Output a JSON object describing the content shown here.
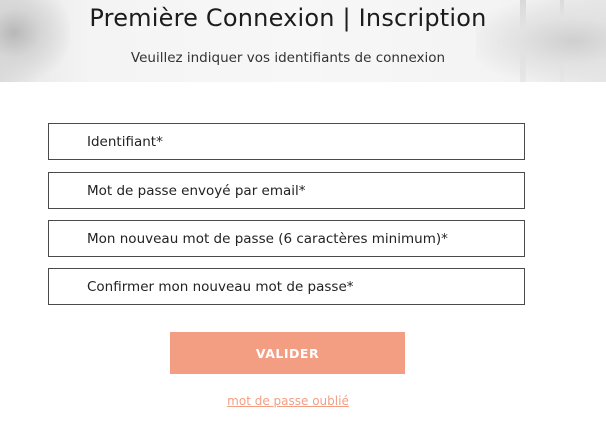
{
  "header": {
    "title": "Première Connexion | Inscription",
    "subtitle": "Veuillez indiquer vos identifiants de connexion"
  },
  "form": {
    "fields": [
      {
        "placeholder": "Identifiant*",
        "value": ""
      },
      {
        "placeholder": "Mot de passe envoyé par email*",
        "value": ""
      },
      {
        "placeholder": "Mon nouveau mot de passe (6 caractères minimum)*",
        "value": ""
      },
      {
        "placeholder": "Confirmer mon nouveau mot de passe*",
        "value": ""
      }
    ],
    "submit_label": "VALIDER",
    "forgot_password_label": "mot de passe oublié"
  },
  "colors": {
    "accent": "#f39e83",
    "field_border": "#4a4a4a",
    "text": "#222222"
  }
}
